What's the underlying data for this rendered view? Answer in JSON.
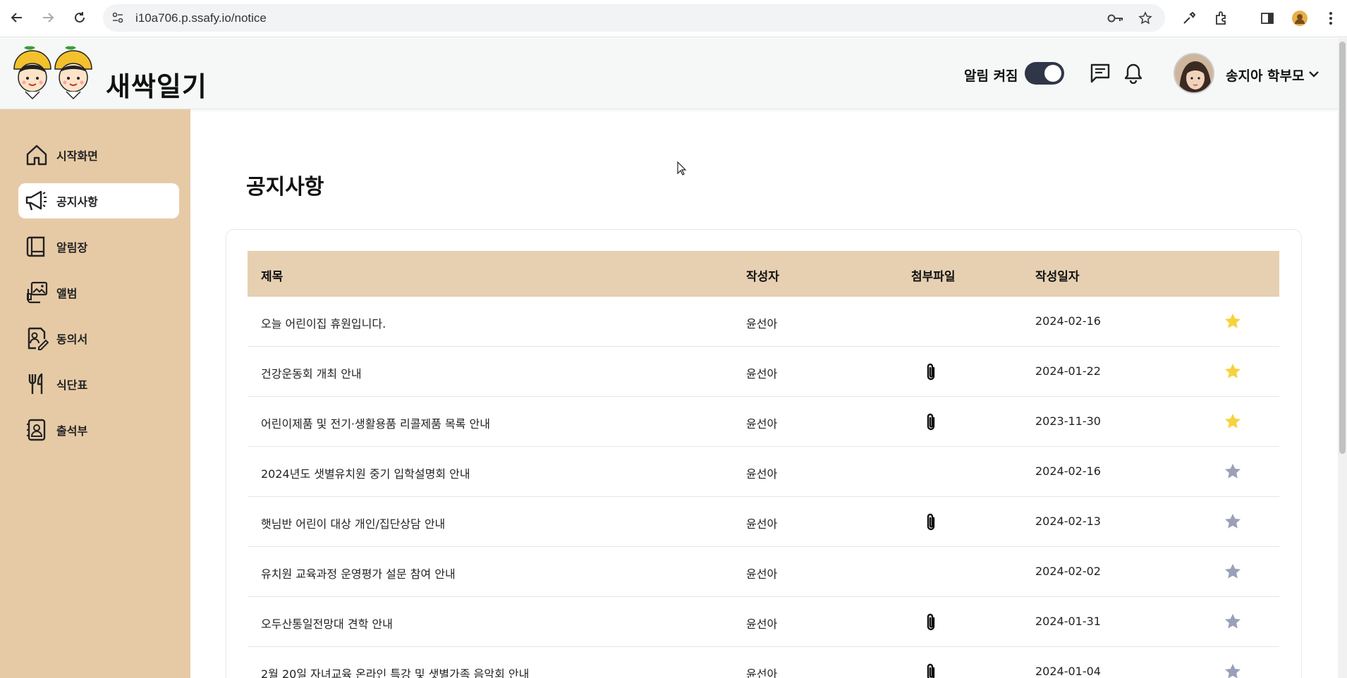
{
  "browser": {
    "url": "i10a706.p.ssafy.io/notice"
  },
  "header": {
    "logo_text": "새싹일기",
    "alarm_label": "알림 켜짐",
    "alarm_on": true,
    "user_name": "송지아 학부모"
  },
  "sidebar": {
    "items": [
      {
        "label": "시작화면",
        "icon": "home-icon"
      },
      {
        "label": "공지사항",
        "icon": "megaphone-icon",
        "active": true
      },
      {
        "label": "알림장",
        "icon": "notebook-icon"
      },
      {
        "label": "앨범",
        "icon": "album-icon"
      },
      {
        "label": "동의서",
        "icon": "consent-icon"
      },
      {
        "label": "식단표",
        "icon": "fork-knife-icon"
      },
      {
        "label": "출석부",
        "icon": "attendance-icon"
      }
    ]
  },
  "main": {
    "title": "공지사항",
    "columns": {
      "title": "제목",
      "author": "작성자",
      "attachment": "첨부파일",
      "date": "작성일자"
    },
    "rows": [
      {
        "title": "오늘 어린이집 휴원입니다.",
        "author": "윤선아",
        "attachment": false,
        "date": "2024-02-16",
        "starred": true
      },
      {
        "title": "건강운동회 개최 안내",
        "author": "윤선아",
        "attachment": true,
        "date": "2024-01-22",
        "starred": true
      },
      {
        "title": "어린이제품 및 전기·생활용품 리콜제품 목록 안내",
        "author": "윤선아",
        "attachment": true,
        "date": "2023-11-30",
        "starred": true
      },
      {
        "title": "2024년도 샛별유치원 중기 입학설명회 안내",
        "author": "윤선아",
        "attachment": false,
        "date": "2024-02-16",
        "starred": false
      },
      {
        "title": "햇님반 어린이 대상 개인/집단상담 안내",
        "author": "윤선아",
        "attachment": true,
        "date": "2024-02-13",
        "starred": false
      },
      {
        "title": "유치원 교육과정 운영평가 설문 참여 안내",
        "author": "윤선아",
        "attachment": false,
        "date": "2024-02-02",
        "starred": false
      },
      {
        "title": "오두산통일전망대 견학 안내",
        "author": "윤선아",
        "attachment": true,
        "date": "2024-01-31",
        "starred": false
      },
      {
        "title": "2월 20일 자녀교육 온라인 특강 및 샛별가족 음악회 안내",
        "author": "윤선아",
        "attachment": true,
        "date": "2024-01-04",
        "starred": false
      }
    ]
  },
  "colors": {
    "sidebar_bg": "#e6caa6",
    "table_header_bg": "#e6d0b1",
    "star_on": "#f7d23e",
    "star_off": "#9aa0b8",
    "toggle_bg": "#2f3647"
  }
}
